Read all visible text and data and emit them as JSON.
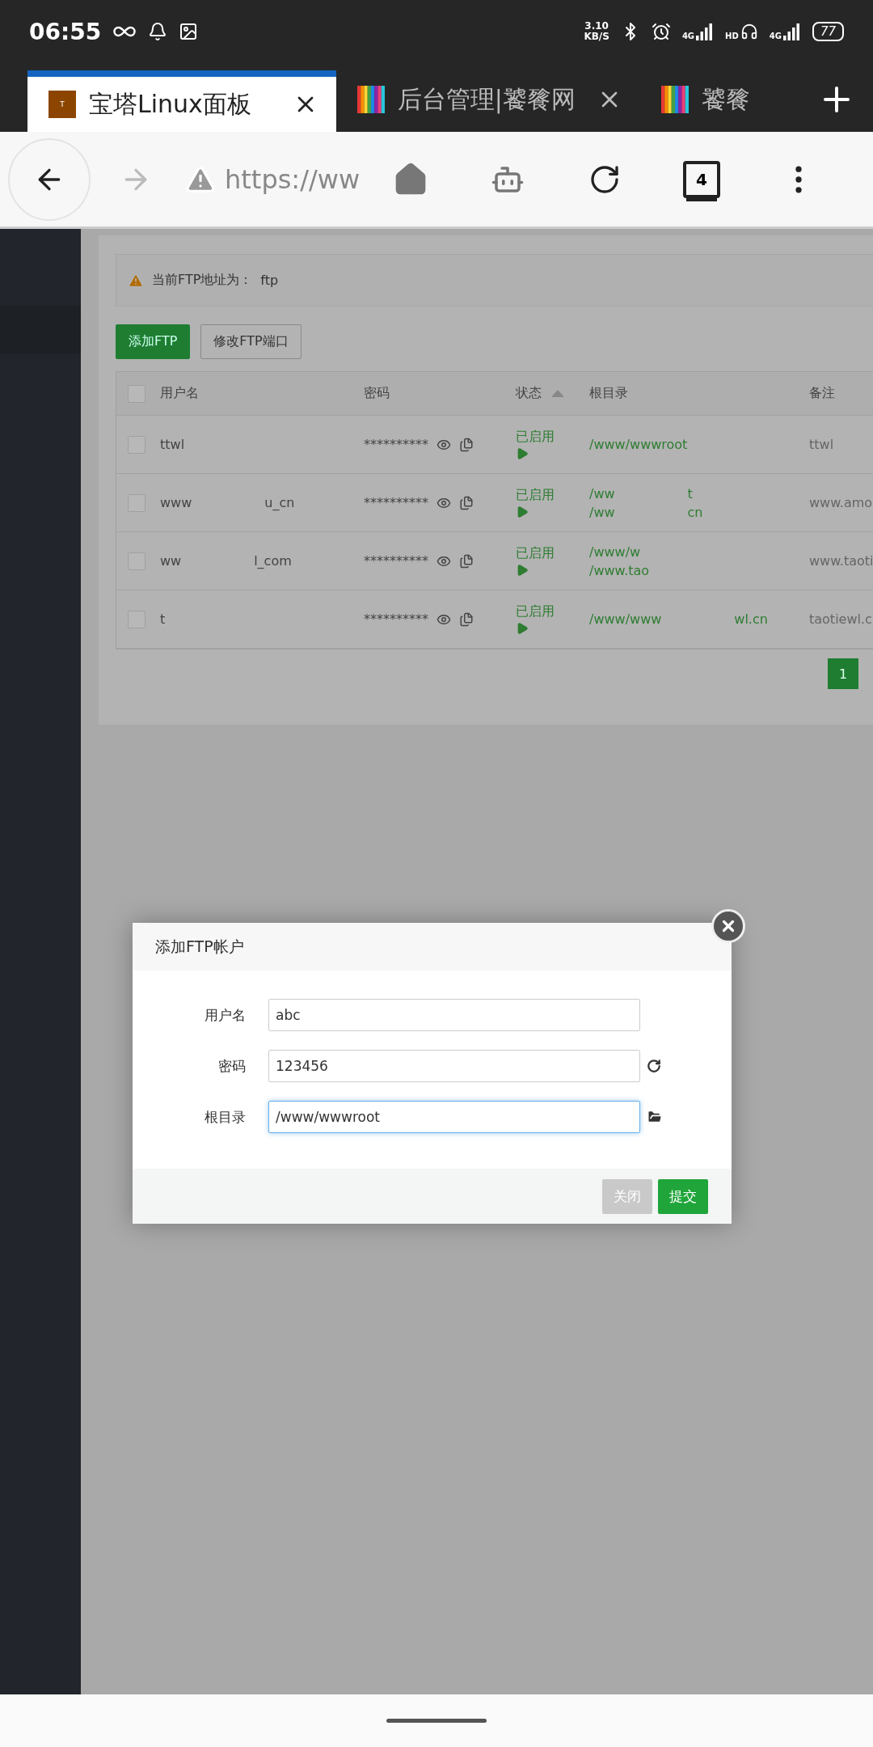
{
  "status_bar": {
    "time": "06:55",
    "net_speed": "3.10",
    "net_unit": "KB/S",
    "indicators": [
      {
        "kind": "signal",
        "label": "4G"
      },
      {
        "kind": "hd",
        "label": "HD"
      },
      {
        "kind": "signal",
        "label": "4G"
      }
    ],
    "battery": "77"
  },
  "tabs": [
    {
      "title": "宝塔Linux面板",
      "favicon": "T",
      "kind": "letter",
      "selected": true
    },
    {
      "title": "后台管理|饕餮网",
      "kind": "stripes",
      "selected": false
    },
    {
      "title": "饕餮",
      "kind": "stripes",
      "selected": false
    }
  ],
  "address_bar": {
    "url": "https://ww",
    "tab_count": "4"
  },
  "ftp_panel": {
    "notice_label": "当前FTP地址为：",
    "notice_value": "ftp",
    "buttons": [
      {
        "label": "添加FTP",
        "kind": "primary"
      },
      {
        "label": "修改FTP端口",
        "kind": "default"
      }
    ],
    "select_all": {
      "checked": false
    },
    "columns": [
      {
        "label": "用户名"
      },
      {
        "label": "密码"
      },
      {
        "label": "状态",
        "sorted": true
      },
      {
        "label": "根目录"
      },
      {
        "label": "备注"
      }
    ],
    "rows": [
      {
        "checked": false,
        "username": [
          "ttwl"
        ],
        "password": "**********",
        "status": "已启用",
        "root": [
          [
            "/www/wwwroot"
          ]
        ],
        "note": [
          "ttwl"
        ]
      },
      {
        "checked": false,
        "username": [
          "www",
          "u_cn"
        ],
        "password": "**********",
        "status": "已启用",
        "root": [
          [
            "/ww",
            "t"
          ],
          [
            "/ww",
            "cn"
          ]
        ],
        "note": [
          "www.amo"
        ]
      },
      {
        "checked": false,
        "username": [
          "ww",
          "l_com"
        ],
        "password": "**********",
        "status": "已启用",
        "root": [
          [
            "/www/w"
          ],
          [
            "/www.tao"
          ]
        ],
        "note": [
          "www.taoti"
        ]
      },
      {
        "checked": false,
        "username": [
          "t"
        ],
        "password": "**********",
        "status": "已启用",
        "root": [
          [
            "/www/www",
            "wl.cn"
          ]
        ],
        "note": [
          "taotiewl.c"
        ]
      }
    ],
    "pagination": [
      {
        "label": "1",
        "selected": true
      }
    ]
  },
  "dialog": {
    "title": "添加FTP帐户",
    "fields": [
      {
        "label": "用户名",
        "value": "abc",
        "kind": "text",
        "focused": false
      },
      {
        "label": "密码",
        "value": "123456",
        "kind": "refresh",
        "focused": false
      },
      {
        "label": "根目录",
        "value": "/www/wwwroot",
        "kind": "folder",
        "focused": true
      }
    ],
    "buttons": [
      {
        "label": "关闭",
        "kind": "default"
      },
      {
        "label": "提交",
        "kind": "primary"
      }
    ]
  }
}
